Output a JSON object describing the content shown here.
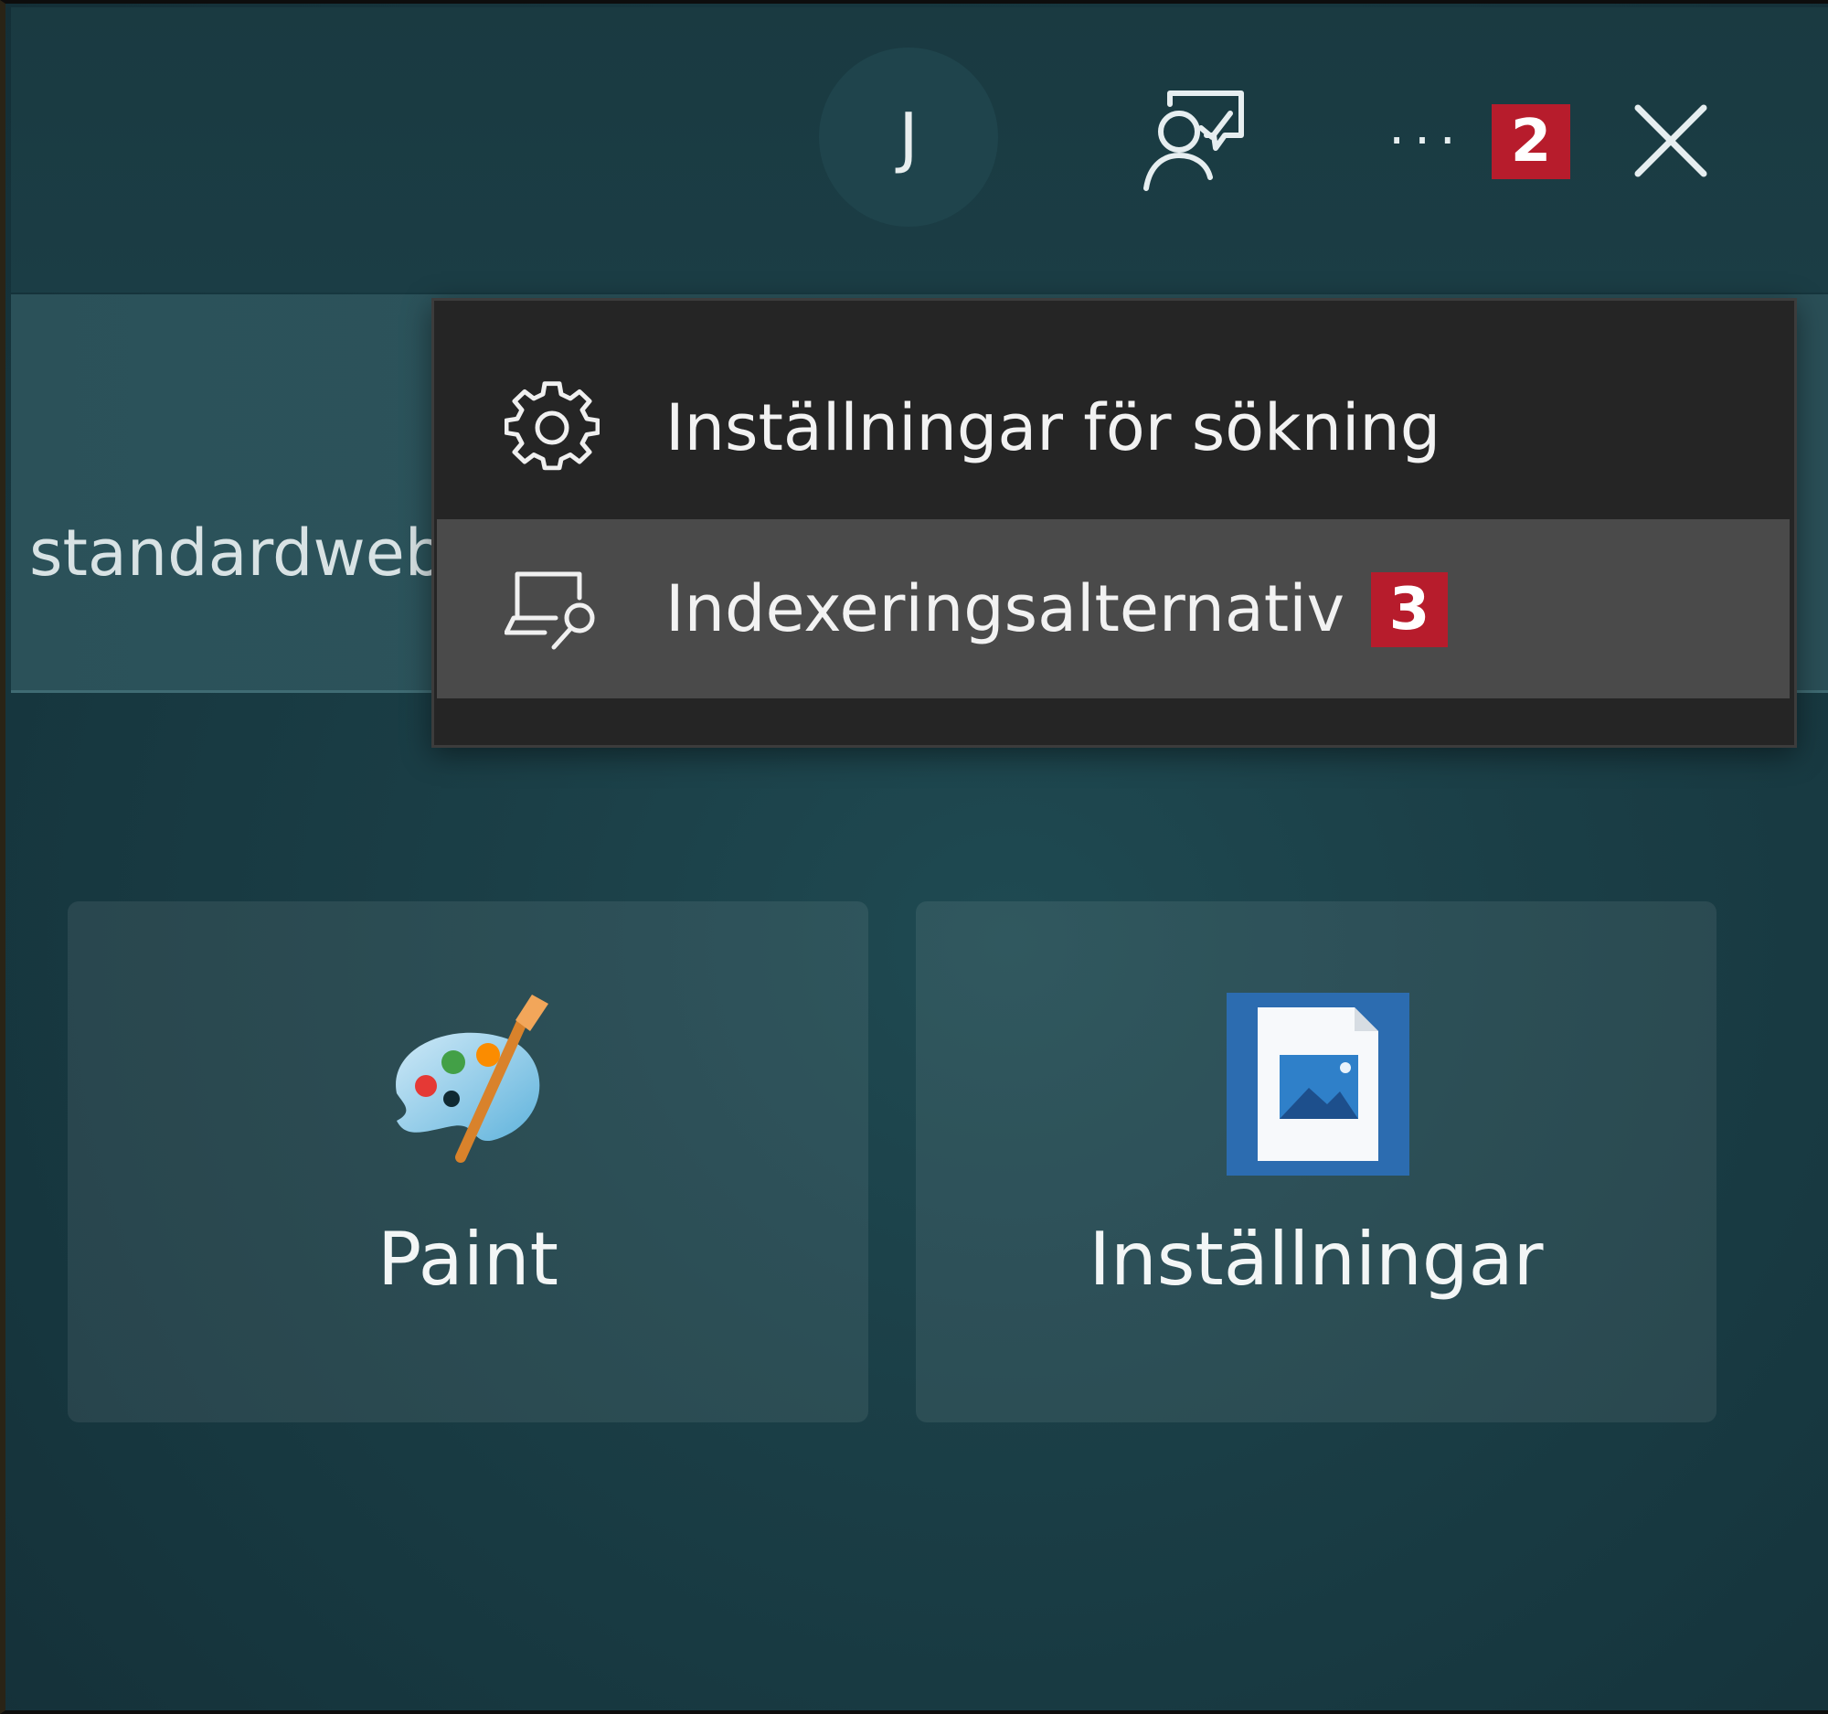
{
  "topbar": {
    "avatar_initial": "J",
    "feedback_icon": "feedback-person-icon",
    "more_label": "···",
    "close_icon": "close-icon",
    "badge_more": "2"
  },
  "search": {
    "visible_text": "standardweb"
  },
  "menu": {
    "items": [
      {
        "icon": "gear-icon",
        "label": "Inställningar för sökning"
      },
      {
        "icon": "indexing-options-icon",
        "label": "Indexeringsalternativ",
        "badge": "3"
      }
    ]
  },
  "apps": [
    {
      "icon": "paint-palette-icon",
      "label": "Paint"
    },
    {
      "icon": "image-file-icon",
      "label": "Inställningar"
    }
  ],
  "colors": {
    "background": "#1b3f47",
    "menu_background": "#252525",
    "menu_highlight": "#4a4a4a",
    "badge": "#b71c2c",
    "text": "#f2f2f2"
  }
}
